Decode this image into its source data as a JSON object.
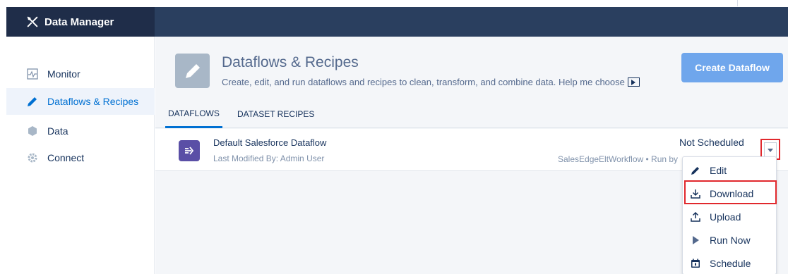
{
  "app": {
    "title": "Data Manager",
    "header_color": "#2a3f5f",
    "icon": "data-manager-tools-icon"
  },
  "sidebar": {
    "items": [
      {
        "label": "Monitor",
        "icon": "monitor-pulse-icon"
      },
      {
        "label": "Dataflows & Recipes",
        "icon": "pencil-icon",
        "active": true
      },
      {
        "label": "Data",
        "icon": "hexagon-icon"
      },
      {
        "label": "Connect",
        "icon": "gear-icon"
      }
    ]
  },
  "page": {
    "title": "Dataflows & Recipes",
    "subtitle": "Create, edit, and run dataflows and recipes to clean, transform, and combine data. Help me choose",
    "icon": "pencil-icon",
    "create_button": "Create Dataflow"
  },
  "tabs": [
    {
      "label": "DATAFLOWS",
      "active": true
    },
    {
      "label": "DATASET RECIPES",
      "active": false
    }
  ],
  "dataflow": {
    "name": "Default Salesforce Dataflow",
    "modified": "Last Modified By: Admin User",
    "status": "Not Scheduled",
    "meta": "SalesEdgeEltWorkflow • Run by",
    "icon": "dataflow-icon"
  },
  "menu": {
    "items": [
      {
        "label": "Edit",
        "icon": "pencil-icon"
      },
      {
        "label": "Download",
        "icon": "download-icon",
        "highlighted": true
      },
      {
        "label": "Upload",
        "icon": "upload-icon"
      },
      {
        "label": "Run Now",
        "icon": "play-icon"
      },
      {
        "label": "Schedule",
        "icon": "calendar-icon"
      }
    ]
  },
  "colors": {
    "accent": "#0070d2",
    "highlight": "#e1282d",
    "button": "#6fa6ec"
  }
}
